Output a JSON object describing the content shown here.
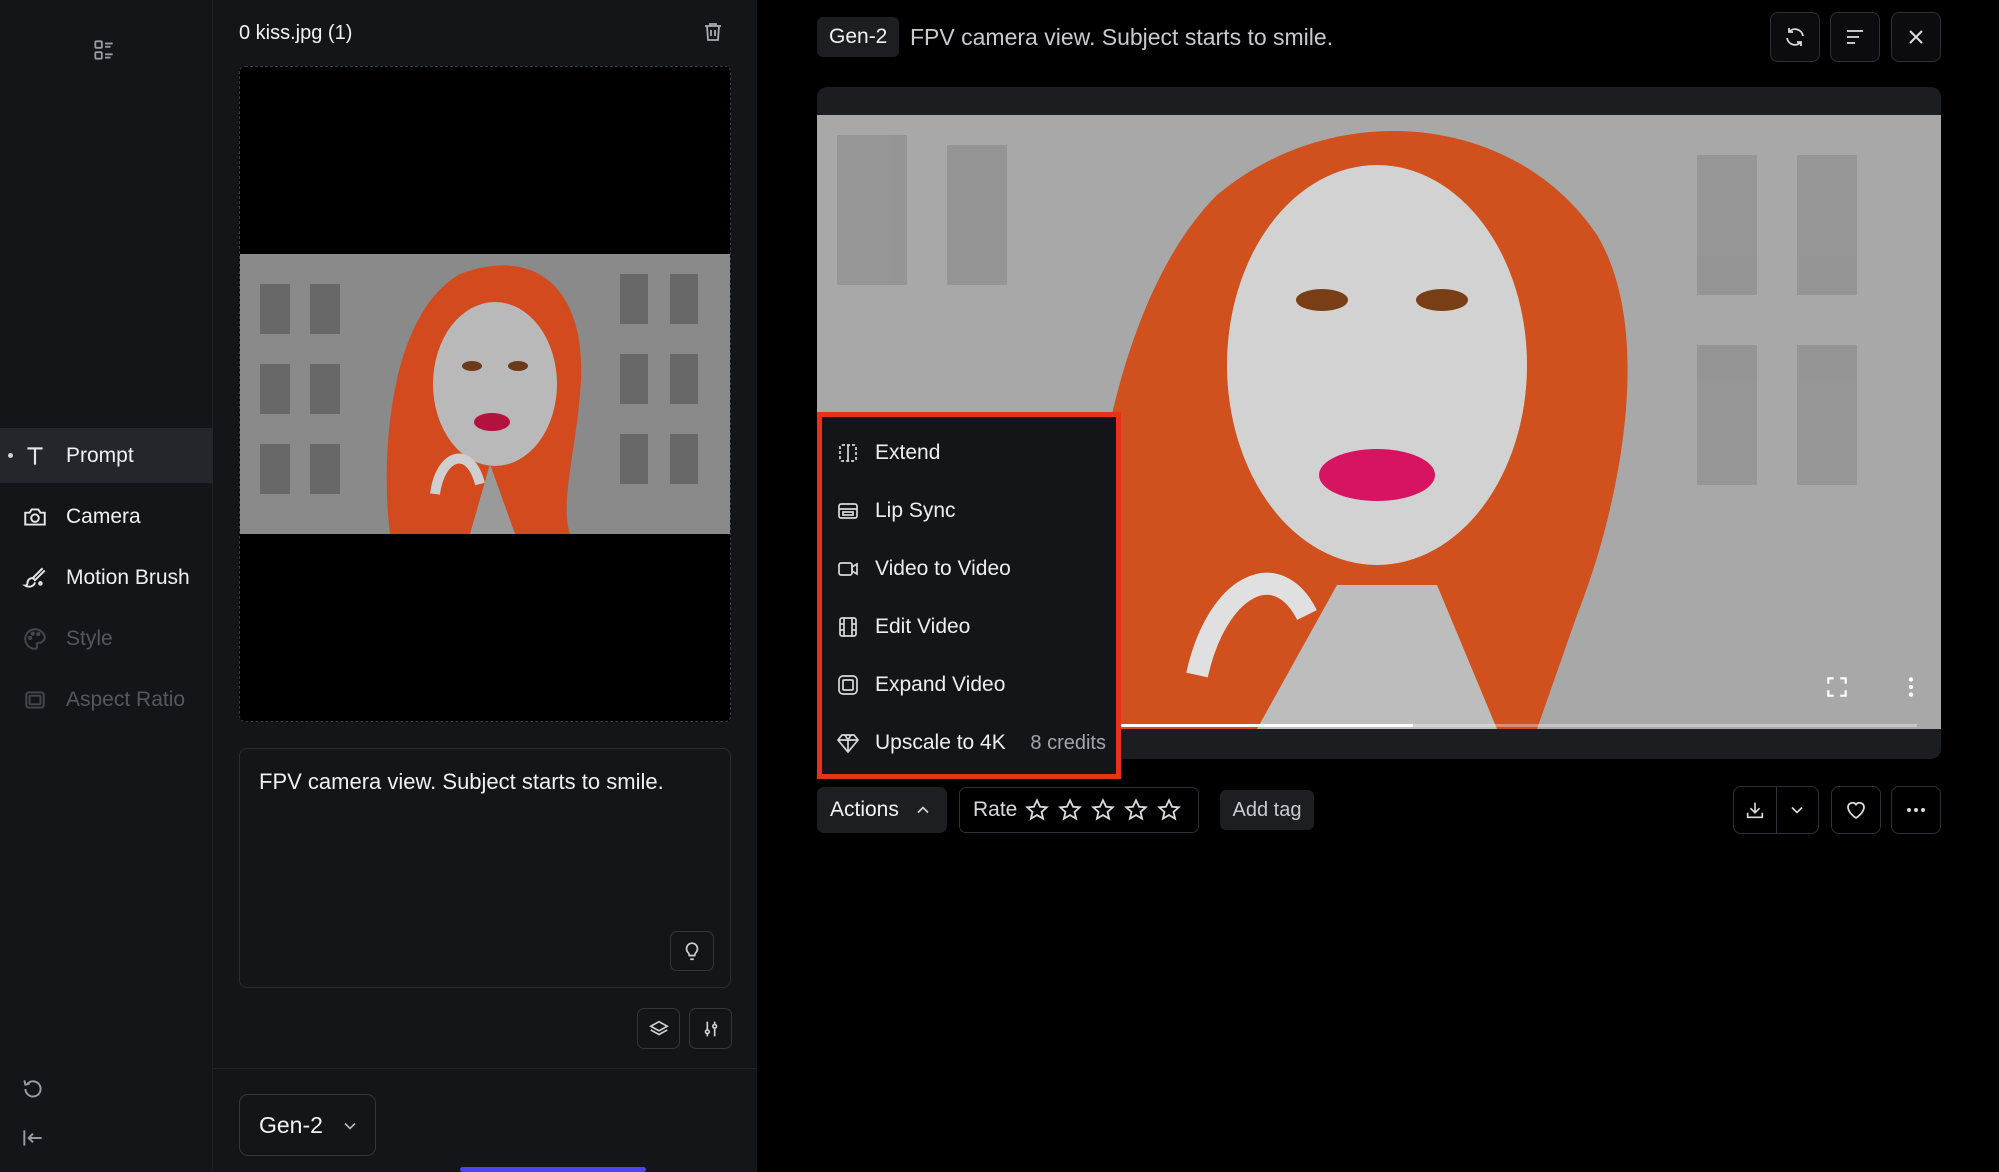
{
  "sidebar": {
    "items": [
      {
        "label": "Prompt",
        "icon": "text-icon",
        "active": true
      },
      {
        "label": "Camera",
        "icon": "camera-icon"
      },
      {
        "label": "Motion Brush",
        "icon": "brush-icon"
      },
      {
        "label": "Style",
        "icon": "palette-icon",
        "disabled": true
      },
      {
        "label": "Aspect Ratio",
        "icon": "aspect-ratio-icon",
        "disabled": true
      }
    ]
  },
  "panel": {
    "file_name": "0 kiss.jpg (1)",
    "prompt_text": "FPV camera view. Subject starts to smile.",
    "model": "Gen-2"
  },
  "header": {
    "model_badge": "Gen-2",
    "prompt": "FPV camera view. Subject starts to smile."
  },
  "actions_menu": {
    "items": [
      {
        "label": "Extend",
        "icon": "extend-icon"
      },
      {
        "label": "Lip Sync",
        "icon": "lip-sync-icon"
      },
      {
        "label": "Video to Video",
        "icon": "video-camera-icon"
      },
      {
        "label": "Edit Video",
        "icon": "film-icon"
      },
      {
        "label": "Expand Video",
        "icon": "expand-video-icon"
      },
      {
        "label": "Upscale to 4K",
        "icon": "diamond-icon",
        "credits": "8 credits"
      }
    ]
  },
  "toolbar": {
    "actions_label": "Actions",
    "rate_label": "Rate",
    "rating": 0,
    "max_rating": 5,
    "tag_label": "Add tag"
  },
  "video": {
    "progress": 0.37
  },
  "colors": {
    "highlight": "#e8301c",
    "accent": "#4b45f5"
  }
}
